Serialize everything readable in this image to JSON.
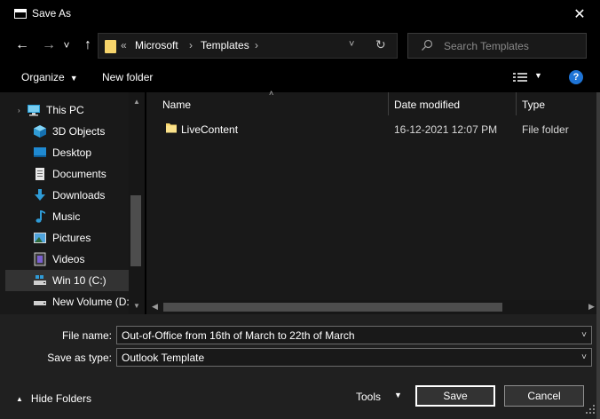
{
  "window": {
    "title": "Save As",
    "close_glyph": "✕"
  },
  "nav": {
    "back_glyph": "←",
    "forward_glyph": "→",
    "recent_glyph": "˅",
    "up_glyph": "↑"
  },
  "address": {
    "overflow": "«",
    "crumbs": [
      "Microsoft",
      "Templates"
    ],
    "separator": "›",
    "dropdown_glyph": "˅",
    "refresh_glyph": "↻"
  },
  "search": {
    "placeholder": "Search Templates"
  },
  "toolbar": {
    "organize_label": "Organize",
    "new_folder_label": "New folder",
    "help_label": "?"
  },
  "sidebar": {
    "items": [
      {
        "label": "This PC",
        "icon": "pc-icon",
        "expandable": true
      },
      {
        "label": "3D Objects",
        "icon": "3d-objects-icon"
      },
      {
        "label": "Desktop",
        "icon": "desktop-icon"
      },
      {
        "label": "Documents",
        "icon": "documents-icon"
      },
      {
        "label": "Downloads",
        "icon": "downloads-icon"
      },
      {
        "label": "Music",
        "icon": "music-icon"
      },
      {
        "label": "Pictures",
        "icon": "pictures-icon"
      },
      {
        "label": "Videos",
        "icon": "videos-icon"
      },
      {
        "label": "Win 10 (C:)",
        "icon": "drive-icon",
        "selected": true
      },
      {
        "label": "New Volume (D:",
        "icon": "drive-icon"
      }
    ]
  },
  "file_list": {
    "columns": [
      "Name",
      "Date modified",
      "Type"
    ],
    "rows": [
      {
        "name": "LiveContent",
        "date_modified": "16-12-2021 12:07 PM",
        "type": "File folder"
      }
    ]
  },
  "form": {
    "file_name_label": "File name:",
    "file_name_value": "Out-of-Office from 16th of March to 22th of March",
    "save_type_label": "Save as type:",
    "save_type_value": "Outlook Template"
  },
  "footer": {
    "hide_folders_label": "Hide Folders",
    "tools_label": "Tools",
    "save_label": "Save",
    "cancel_label": "Cancel"
  },
  "colors": {
    "accent": "#1e74d6",
    "folder": "#f6d46b"
  }
}
